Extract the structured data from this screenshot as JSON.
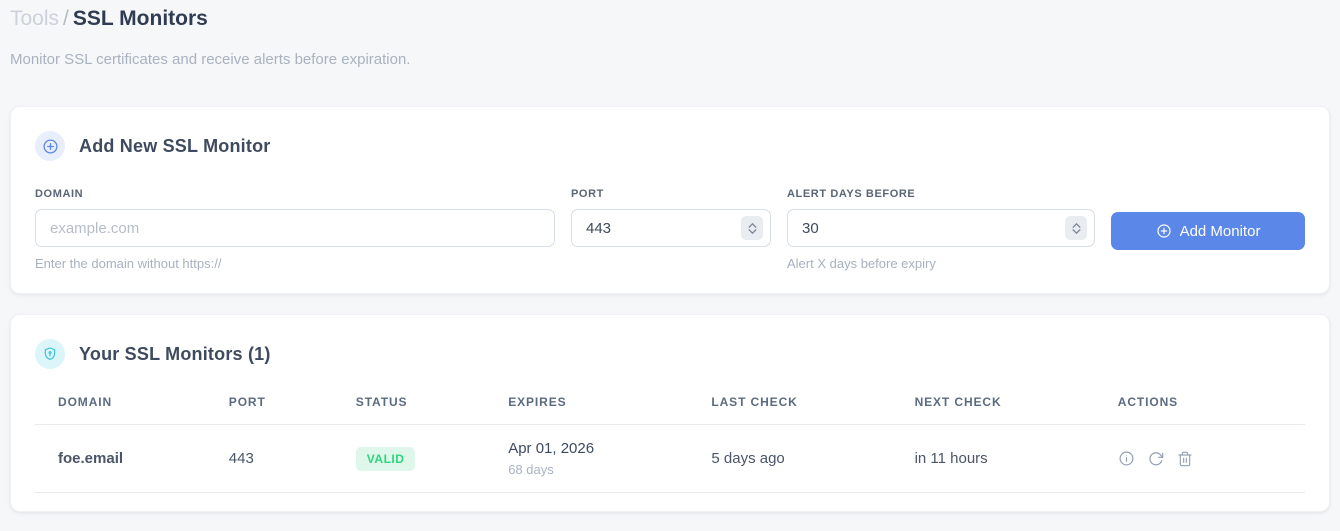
{
  "breadcrumb": {
    "section": "Tools",
    "separator": "/",
    "page": "SSL Monitors"
  },
  "subtitle": "Monitor SSL certificates and receive alerts before expiration.",
  "add_card": {
    "title": "Add New SSL Monitor",
    "fields": {
      "domain": {
        "label": "DOMAIN",
        "placeholder": "example.com",
        "helper": "Enter the domain without https://"
      },
      "port": {
        "label": "PORT",
        "value": "443"
      },
      "alert_days": {
        "label": "ALERT DAYS BEFORE",
        "value": "30",
        "helper": "Alert X days before expiry"
      }
    },
    "submit_label": "Add Monitor"
  },
  "monitors_card": {
    "title": "Your SSL Monitors (1)",
    "table": {
      "headers": [
        "DOMAIN",
        "PORT",
        "STATUS",
        "EXPIRES",
        "LAST CHECK",
        "NEXT CHECK",
        "ACTIONS"
      ],
      "rows": [
        {
          "domain": "foe.email",
          "port": "443",
          "status": "VALID",
          "expires_date": "Apr 01, 2026",
          "expires_days": "68 days",
          "last_check": "5 days ago",
          "next_check": "in 11 hours"
        }
      ]
    }
  },
  "icons": {
    "add_section": "plus-circle",
    "monitors_section": "shield",
    "row_actions": [
      "info",
      "refresh",
      "trash"
    ]
  },
  "colors": {
    "accent": "#5b87e8",
    "accent_bg": "#e8eefc",
    "cyan": "#3cc5d6",
    "cyan_bg": "#dcf5f8",
    "valid_text": "#2fd57f",
    "valid_bg": "#def7ea",
    "link": "#5b8cf0"
  }
}
